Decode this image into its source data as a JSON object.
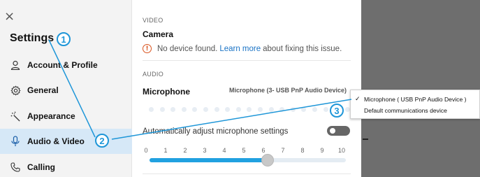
{
  "sidebar": {
    "close_glyph": "×",
    "title": "Settings",
    "items": [
      {
        "label": "Account & Profile",
        "icon": "person-icon"
      },
      {
        "label": "General",
        "icon": "gear-icon"
      },
      {
        "label": "Appearance",
        "icon": "magic-wand-icon"
      },
      {
        "label": "Audio & Video",
        "icon": "microphone-icon",
        "active": true
      },
      {
        "label": "Calling",
        "icon": "phone-icon"
      }
    ]
  },
  "content": {
    "video_section": "VIDEO",
    "camera_title": "Camera",
    "warning_icon": "!",
    "warning_before": "No device found.",
    "warning_link": "Learn more",
    "warning_after": "about fixing this issue.",
    "audio_section": "AUDIO",
    "microphone_title": "Microphone",
    "microphone_value": "Microphone (3- USB PnP Audio Device)",
    "auto_adjust_label": "Automatically adjust microphone settings",
    "auto_adjust_on": false,
    "slider_ticks": [
      "0",
      "1",
      "2",
      "3",
      "4",
      "5",
      "6",
      "7",
      "8",
      "9",
      "10"
    ],
    "slider_value": 6
  },
  "dropdown": {
    "check_glyph": "✓",
    "options": [
      {
        "label": "Microphone ( USB PnP Audio Device )",
        "selected": true
      },
      {
        "label": "Default communications device",
        "selected": false
      }
    ]
  },
  "annotations": [
    "1",
    "2",
    "3"
  ],
  "colors": {
    "accent": "#1e96d8",
    "link": "#1a73c5",
    "warning": "#d9531e",
    "active_item_bg": "#d6e8f7"
  }
}
